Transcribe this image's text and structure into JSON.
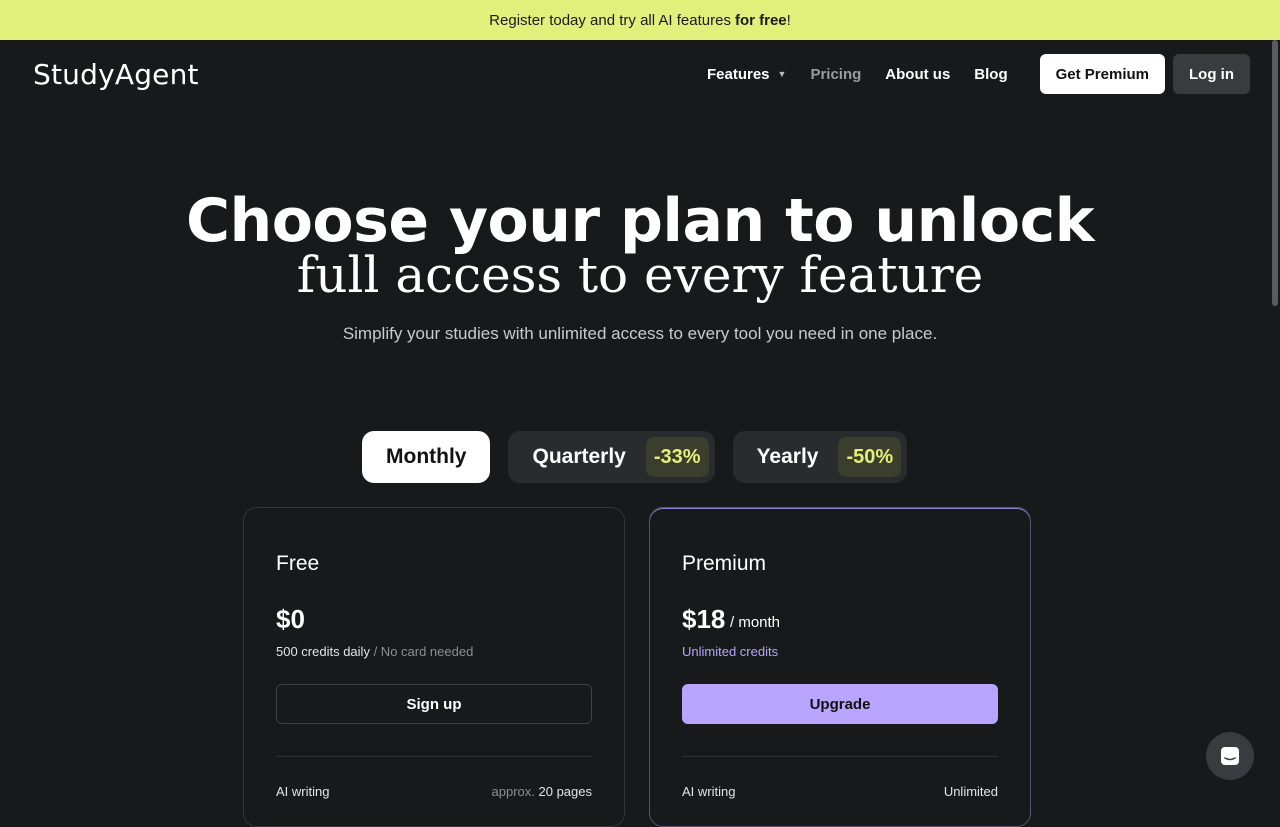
{
  "banner": {
    "text": "Register today and try all AI features",
    "bold": "for free",
    "suffix": "!"
  },
  "logo": "StudyAgent",
  "nav": {
    "features": "Features",
    "pricing": "Pricing",
    "about": "About us",
    "blog": "Blog",
    "get_premium": "Get Premium",
    "login": "Log in"
  },
  "hero": {
    "headline_line1": "Choose your plan to unlock",
    "headline_line2": "full access to every feature",
    "subheadline": "Simplify your studies with unlimited access to every tool you need in one place."
  },
  "billing_tabs": [
    {
      "label": "Monthly",
      "discount": "",
      "active": true
    },
    {
      "label": "Quarterly",
      "discount": "-33%",
      "active": false
    },
    {
      "label": "Yearly",
      "discount": "-50%",
      "active": false
    }
  ],
  "plans": [
    {
      "name": "Free",
      "price": "$0",
      "period": "",
      "credits": "500 credits daily",
      "credits_note": "/ No card needed",
      "cta": "Sign up",
      "feature_name": "AI writing",
      "feature_value_prefix": "approx.",
      "feature_value": "20 pages"
    },
    {
      "name": "Premium",
      "price": "$18",
      "period": "/ month",
      "credits": "Unlimited credits",
      "credits_note": "",
      "cta": "Upgrade",
      "feature_name": "AI writing",
      "feature_value_prefix": "",
      "feature_value": "Unlimited"
    }
  ],
  "colors": {
    "accent_lime": "#e0f07a",
    "accent_purple": "#b7a5ff",
    "background": "#18191b"
  }
}
